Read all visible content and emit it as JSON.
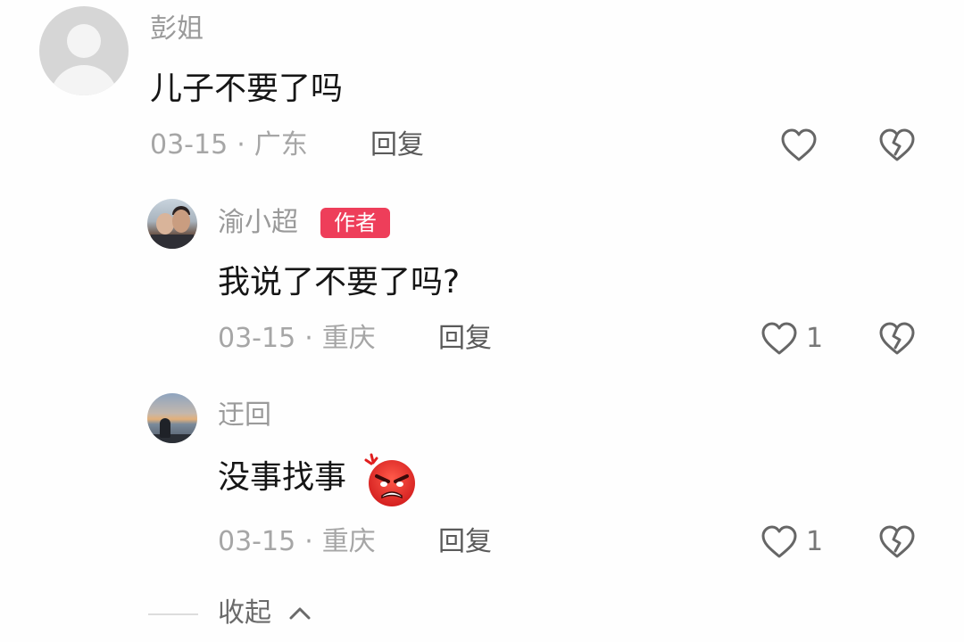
{
  "comments": [
    {
      "username": "彭姐",
      "text": "儿子不要了吗",
      "date": "03-15",
      "location": "广东",
      "reply_label": "回复",
      "likes": "",
      "avatar": "default-avatar"
    },
    {
      "username": "渝小超",
      "badge": "作者",
      "text": "我说了不要了吗?",
      "date": "03-15",
      "location": "重庆",
      "reply_label": "回复",
      "likes": "1",
      "avatar": "photo-avatar"
    },
    {
      "username": "迂回",
      "text": "没事找事",
      "emoji": "angry-face-emoji",
      "date": "03-15",
      "location": "重庆",
      "reply_label": "回复",
      "likes": "1",
      "avatar": "photo-avatar"
    }
  ],
  "separator": "·",
  "collapse": {
    "label": "收起",
    "icon": "chevron-up-icon"
  },
  "icons": {
    "like": "heart-outline-icon",
    "dislike": "broken-heart-icon"
  },
  "colors": {
    "badge": "#ee3e5a",
    "username": "#9a9a9a",
    "text": "#161616",
    "meta": "#a6a6a6"
  }
}
